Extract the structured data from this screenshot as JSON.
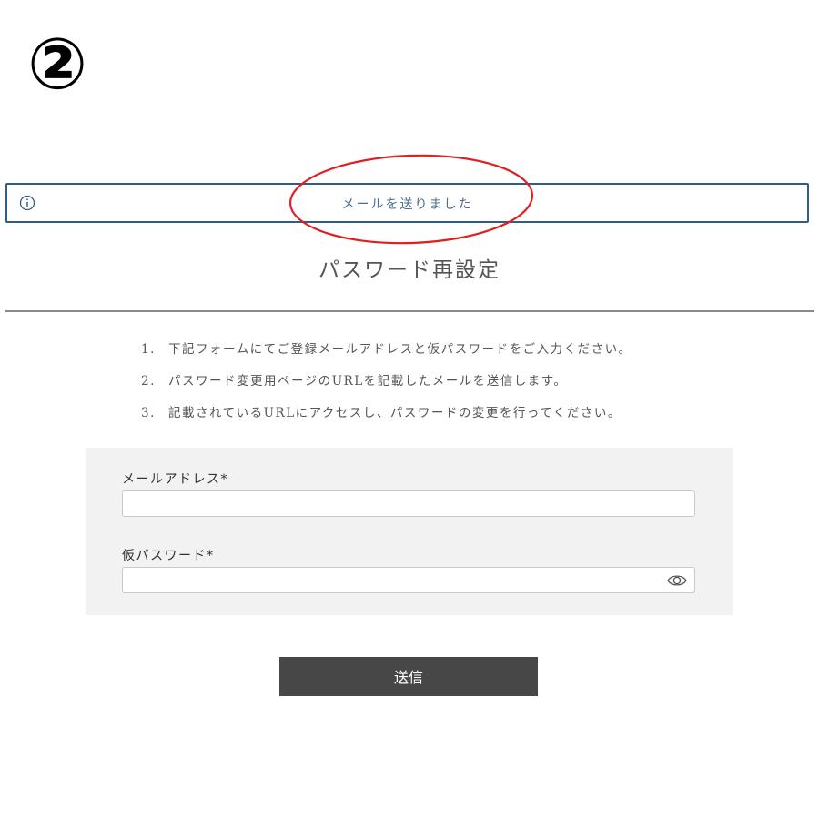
{
  "step_marker": "②",
  "alert": {
    "icon": "info-icon",
    "message": "メールを送りました",
    "border_color": "#2e5e86"
  },
  "annotation": {
    "shape": "ellipse",
    "color": "#e02020"
  },
  "page": {
    "title": "パスワード再設定"
  },
  "instructions": [
    {
      "num": "1.",
      "text": "下記フォームにてご登録メールアドレスと仮パスワードをご入力ください。"
    },
    {
      "num": "2.",
      "text": "パスワード変更用ページのURLを記載したメールを送信します。"
    },
    {
      "num": "3.",
      "text": "記載されているURLにアクセスし、パスワードの変更を行ってください。"
    }
  ],
  "form": {
    "email": {
      "label": "メールアドレス",
      "required_mark": "*",
      "value": ""
    },
    "temp_password": {
      "label": "仮パスワード",
      "required_mark": "*",
      "value": "",
      "toggle_icon": "eye-icon"
    },
    "submit_label": "送信"
  }
}
